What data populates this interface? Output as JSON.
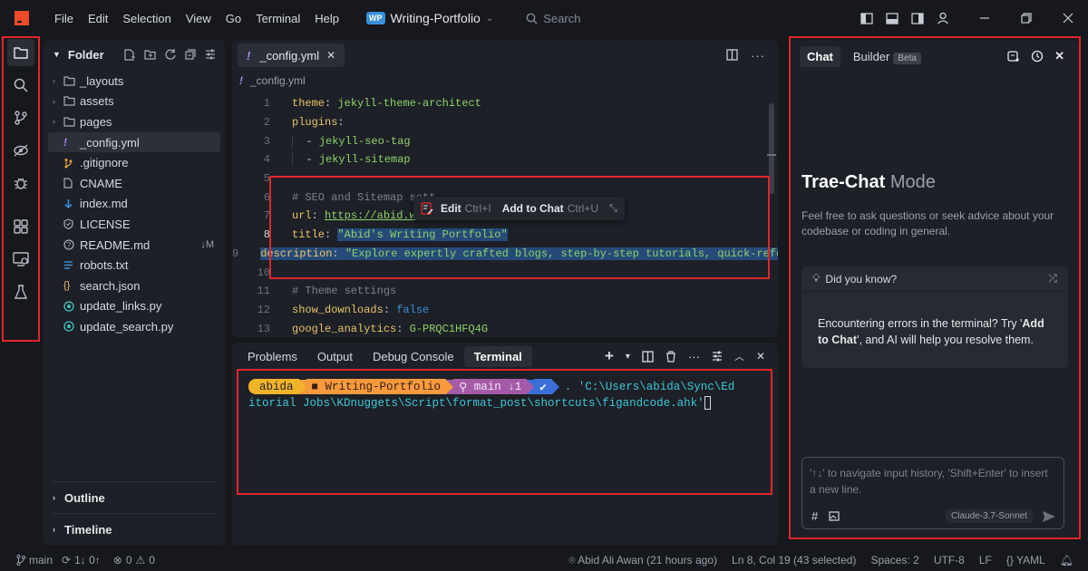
{
  "titlebar": {
    "menu": [
      "File",
      "Edit",
      "Selection",
      "View",
      "Go",
      "Terminal",
      "Help"
    ],
    "project_badge": "WP",
    "project_name": "Writing-Portfolio",
    "search_placeholder": "Search"
  },
  "explorer": {
    "title": "Folder",
    "items": [
      {
        "label": "_layouts",
        "type": "folder"
      },
      {
        "label": "assets",
        "type": "folder"
      },
      {
        "label": "pages",
        "type": "folder"
      },
      {
        "label": "_config.yml",
        "type": "yaml",
        "selected": true
      },
      {
        "label": ".gitignore",
        "type": "git"
      },
      {
        "label": "CNAME",
        "type": "file"
      },
      {
        "label": "index.md",
        "type": "markdown"
      },
      {
        "label": "LICENSE",
        "type": "license"
      },
      {
        "label": "README.md",
        "type": "info",
        "badge": "↓M"
      },
      {
        "label": "robots.txt",
        "type": "text"
      },
      {
        "label": "search.json",
        "type": "json"
      },
      {
        "label": "update_links.py",
        "type": "python"
      },
      {
        "label": "update_search.py",
        "type": "python"
      }
    ],
    "outline": "Outline",
    "timeline": "Timeline"
  },
  "editor": {
    "tab_label": "_config.yml",
    "breadcrumb": "_config.yml",
    "lines": {
      "n1": "1",
      "n2": "2",
      "n3": "3",
      "n4": "4",
      "n5": "5",
      "n6": "6",
      "n7": "7",
      "n8": "8",
      "n9": "9",
      "n10": "10",
      "n11": "11",
      "n12": "12",
      "n13": "13",
      "l1k": "theme",
      "l1v": "jekyll-theme-architect",
      "l2k": "plugins",
      "l3v": "jekyll-seo-tag",
      "l4v": "jekyll-sitemap",
      "l6c": "# SEO and Sitemap sett",
      "l7k": "url",
      "l7v": "https://abid.wor",
      "l8k": "title",
      "l8v": "\"Abid's Writing Portfolio\"",
      "l9k": "description",
      "l9v": "\"Explore expertly crafted blogs, step-by-step tutorials, quick-refe",
      "l11c": "# Theme settings",
      "l12k": "show_downloads",
      "l12v": "false",
      "l13k": "google_analytics",
      "l13v": "G-PRQC1HFQ4G"
    },
    "popup": {
      "edit_label": "Edit",
      "edit_shortcut": "Ctrl+I",
      "add_label": "Add to Chat",
      "add_shortcut": "Ctrl+U"
    }
  },
  "terminal": {
    "tabs": [
      "Problems",
      "Output",
      "Debug Console",
      "Terminal"
    ],
    "active_tab": "Terminal",
    "prompt_user": "abida",
    "prompt_folder": "Writing-Portfolio",
    "prompt_branch": "main ↓1",
    "command_line1": ". 'C:\\Users\\abida\\Sync\\Ed",
    "command_line2": "itorial Jobs\\KDnuggets\\Script\\format_post\\shortcuts\\figandcode.ahk'"
  },
  "chat": {
    "tab_chat": "Chat",
    "tab_builder": "Builder",
    "beta": "Beta",
    "mode_title": "Trae-Chat",
    "mode_word": "Mode",
    "description": "Feel free to ask questions or seek advice about your codebase or coding in general.",
    "dyk_title": "Did you know?",
    "dyk_pre": "Encountering errors in the terminal? Try '",
    "dyk_bold": "Add to Chat",
    "dyk_post": "', and AI will help you resolve them.",
    "input_placeholder": "'↑↓' to navigate input history, 'Shift+Enter' to insert a new line.",
    "model": "Claude-3.7-Sonnet"
  },
  "status": {
    "branch": "main",
    "sync": "1↓ 0↑",
    "errors": "0",
    "warnings": "0",
    "author": "Abid Ali Awan (21 hours ago)",
    "position": "Ln 8, Col 19 (43 selected)",
    "spaces": "Spaces: 2",
    "encoding": "UTF-8",
    "eol": "LF",
    "language": "YAML"
  },
  "colors": {
    "accent_red": "#e0262b",
    "bg": "#16181d",
    "panel": "#1d2027"
  }
}
